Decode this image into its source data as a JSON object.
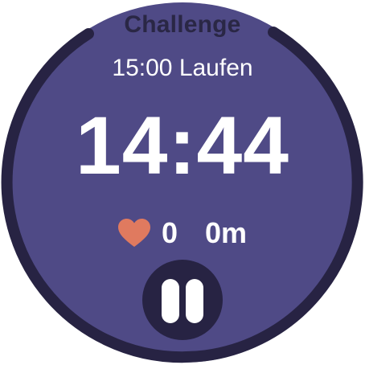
{
  "colors": {
    "background": "#4f4a86",
    "ring": "#272343",
    "title_text": "#2a2745",
    "text": "#ffffff",
    "heart": "#e07a5f",
    "pause_button_bg": "#272343"
  },
  "header": {
    "title": "Challenge"
  },
  "workout": {
    "name": "15:00 Laufen",
    "elapsed_time": "14:44"
  },
  "stats": {
    "heart_rate": "0",
    "distance": "0m",
    "heart_icon": "heart-icon"
  },
  "controls": {
    "pause_icon": "pause-icon"
  }
}
